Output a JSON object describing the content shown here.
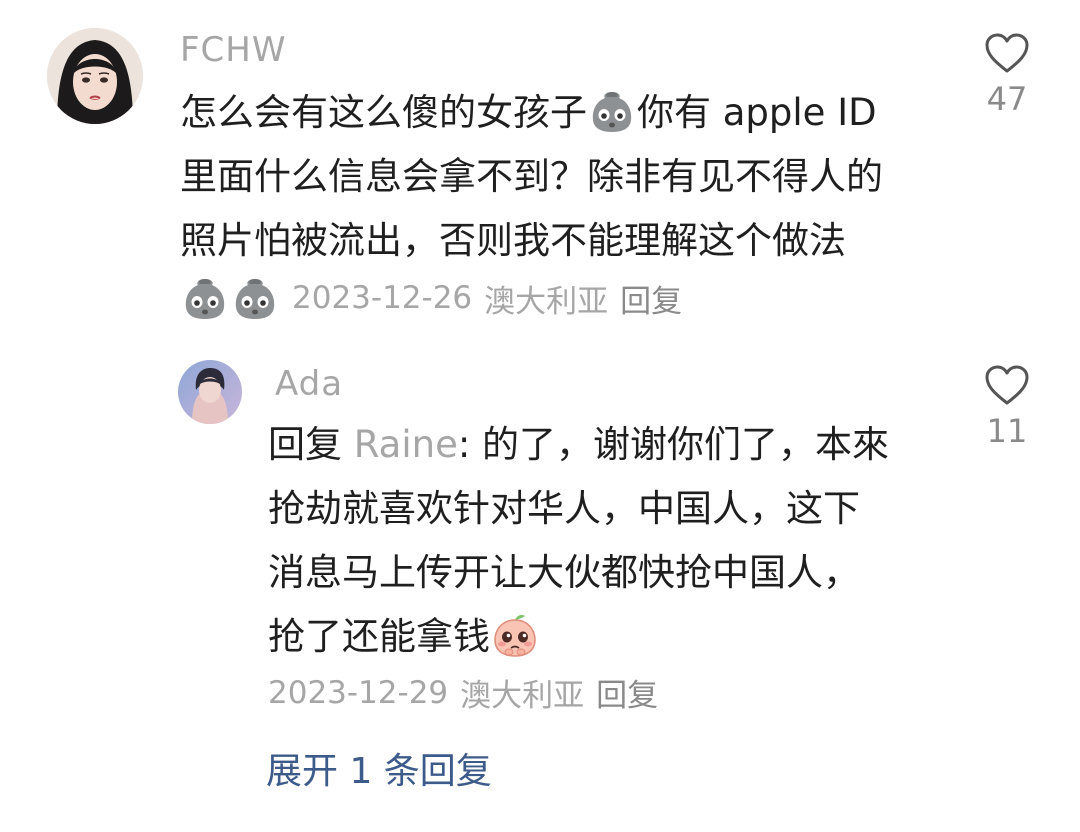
{
  "comments": [
    {
      "username": "FCHW",
      "lines": [
        [
          "怎么会有这么傻的女孩子",
          "@emoji",
          "你有 apple ID"
        ],
        [
          "里面什么信息会拿不到？除非有见不得人的"
        ],
        [
          "照片怕被流出，否则我不能理解这个做法"
        ],
        [
          "@emoji",
          "@emoji"
        ]
      ],
      "line1_a": "怎么会有这么傻的女孩子",
      "line1_b": "你有 apple ID",
      "line2": "里面什么信息会拿不到？除非有见不得人的",
      "line3": "照片怕被流出，否则我不能理解这个做法",
      "date": "2023-12-26",
      "location": "澳大利亚",
      "reply_label": "回复",
      "like_count": "47",
      "emoji_name": "grey-blob-face-emoji"
    }
  ],
  "reply": {
    "username": "Ada",
    "prefix": "回复",
    "mention": "Raine",
    "line1": ": 的了，谢谢你们了，本來",
    "line2": "抢劫就喜欢针对华人，中国人，这下",
    "line3": "消息马上传开让大伙都快抢中国人，",
    "line4": "抢了还能拿钱",
    "date": "2023-12-29",
    "location": "澳大利亚",
    "reply_label": "回复",
    "like_count": "11",
    "emoji_name": "pleading-peach-emoji"
  },
  "expand_label": "展开 1 条回复",
  "icons": {
    "like": "heart-outline-icon"
  },
  "colors": {
    "text": "#1f1f1f",
    "muted": "#a6a6a6",
    "link": "#3c5a8a"
  }
}
